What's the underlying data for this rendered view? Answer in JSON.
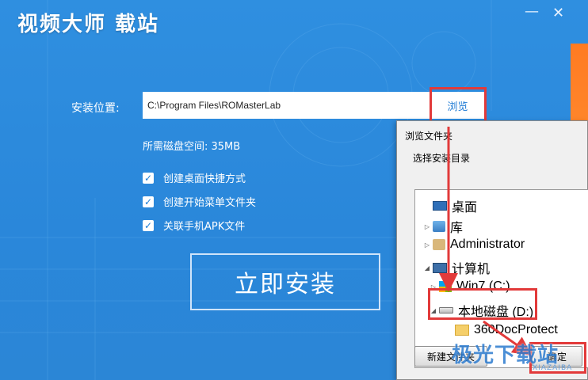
{
  "window": {
    "title": "视频大师 载站",
    "minimize_glyph": "—",
    "close_glyph": "✕"
  },
  "install_path": {
    "label": "安装位置:",
    "value": "C:\\Program Files\\ROMasterLab",
    "browse_label": "浏览"
  },
  "disk_space": "所需磁盘空间: 35MB",
  "options": [
    {
      "label": "创建桌面快捷方式",
      "checked": true
    },
    {
      "label": "创建开始菜单文件夹",
      "checked": true
    },
    {
      "label": "关联手机APK文件",
      "checked": true
    }
  ],
  "install_button": "立即安装",
  "browse_dialog": {
    "title": "浏览文件夹",
    "prompt": "选择安装目录",
    "tree": [
      {
        "label": "桌面",
        "icon": "desktop-icon",
        "expander": ""
      },
      {
        "label": "库",
        "icon": "library-icon",
        "expander": "▷"
      },
      {
        "label": "Administrator",
        "icon": "user-folder-icon",
        "expander": "▷"
      },
      {
        "label": "计算机",
        "icon": "computer-icon",
        "expander": "◢"
      },
      {
        "label": "Win7 (C:)",
        "icon": "windows-drive-icon",
        "expander": "▷"
      },
      {
        "label": "本地磁盘 (D:)",
        "icon": "disk-drive-icon",
        "expander": "◢"
      },
      {
        "label": "360DocProtect",
        "icon": "folder-icon",
        "expander": ""
      }
    ],
    "new_folder_label": "新建文件夹",
    "ok_label": "确定"
  },
  "watermark": {
    "text": "极光下载站",
    "sub": "XIAZAIBA"
  },
  "colors": {
    "background": "#2a87da",
    "highlight_box": "#e23a3a",
    "accent_orange": "#ff7b22"
  }
}
